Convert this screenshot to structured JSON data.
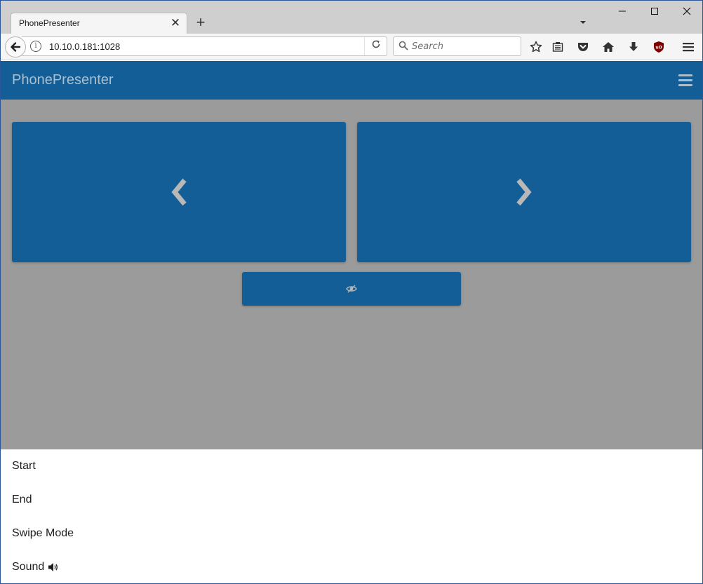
{
  "browser": {
    "tab_title": "PhonePresenter",
    "close_tab_glyph": "✕",
    "new_tab_glyph": "+",
    "url": "10.10.0.181:1028",
    "info_glyph": "i",
    "reload_glyph": "↻",
    "search_placeholder": "Search",
    "window_buttons": {
      "minimize": "—",
      "maximize": "☐",
      "close": "✕"
    }
  },
  "app": {
    "brand": "PhonePresenter",
    "menu_icon": "hamburger-icon",
    "prev_icon": "chevron-left-icon",
    "next_icon": "chevron-right-icon",
    "blank_icon": "eye-slash-icon"
  },
  "menu": {
    "items": [
      {
        "label": "Start"
      },
      {
        "label": "End"
      },
      {
        "label": "Swipe Mode"
      },
      {
        "label": "Sound",
        "icon": "speaker-icon"
      }
    ]
  },
  "colors": {
    "primary": "#135e96",
    "overlay": "#9b9b9b",
    "header_text": "#a9bfd0",
    "icon_muted": "#b8b8b8"
  }
}
